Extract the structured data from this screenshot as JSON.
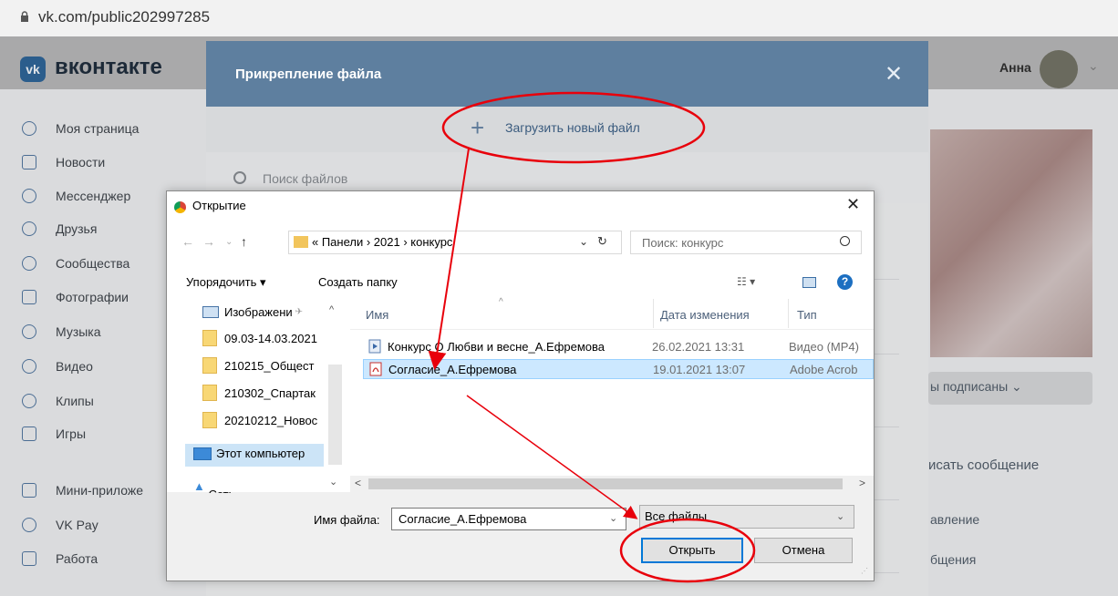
{
  "browser": {
    "url": "vk.com/public202997285"
  },
  "vk": {
    "logo_text": "вконтакте",
    "user_name": "Анна",
    "sidebar": [
      {
        "label": "Моя страница"
      },
      {
        "label": "Новости"
      },
      {
        "label": "Мессенджер"
      },
      {
        "label": "Друзья"
      },
      {
        "label": "Сообщества"
      },
      {
        "label": "Фотографии"
      },
      {
        "label": "Музыка"
      },
      {
        "label": "Видео"
      },
      {
        "label": "Клипы"
      },
      {
        "label": "Игры"
      },
      {
        "label": "Мини-приложе"
      },
      {
        "label": "VK Pay"
      },
      {
        "label": "Работа"
      }
    ],
    "right": {
      "subscribed": "ы подписаны ⌄",
      "write": "исать сообщение",
      "manage": "авление",
      "messages": "бщения"
    }
  },
  "modal": {
    "title": "Прикрепление файла",
    "close": "✕",
    "upload_label": "Загрузить новый файл",
    "upload_plus": "+",
    "search_placeholder": "Поиск файлов"
  },
  "dialog": {
    "title": "Открытие",
    "close": "✕",
    "path": "« Панели  ›  2021  ›  конкурс",
    "search_placeholder": "Поиск: конкурс",
    "organize": "Упорядочить ▾",
    "new_folder": "Создать папку",
    "nav": {
      "pictures": "Изображени",
      "folders": [
        "09.03-14.03.2021",
        "210215_Общест",
        "210302_Спартак",
        "20210212_Новос"
      ],
      "this_pc": "Этот компьютер",
      "network": "Сеть"
    },
    "columns": {
      "name": "Имя",
      "date": "Дата изменения",
      "type": "Тип"
    },
    "files": [
      {
        "name": "Конкурс О Любви и весне_А.Ефремова",
        "date": "26.02.2021 13:31",
        "type": "Видео (MP4)",
        "icon": "video-file-icon"
      },
      {
        "name": "Согласие_А.Ефремова",
        "date": "19.01.2021 13:07",
        "type": "Adobe Acrob",
        "icon": "pdf-file-icon"
      }
    ],
    "filename_label": "Имя файла:",
    "filename_value": "Согласие_А.Ефремова",
    "filetype_value": "Все файлы",
    "open_button": "Открыть",
    "cancel_button": "Отмена"
  },
  "colors": {
    "vk_header": "#5e7f9f",
    "annotation": "#e8000b",
    "selection": "#cce8ff",
    "button_focus": "#0078d7"
  }
}
